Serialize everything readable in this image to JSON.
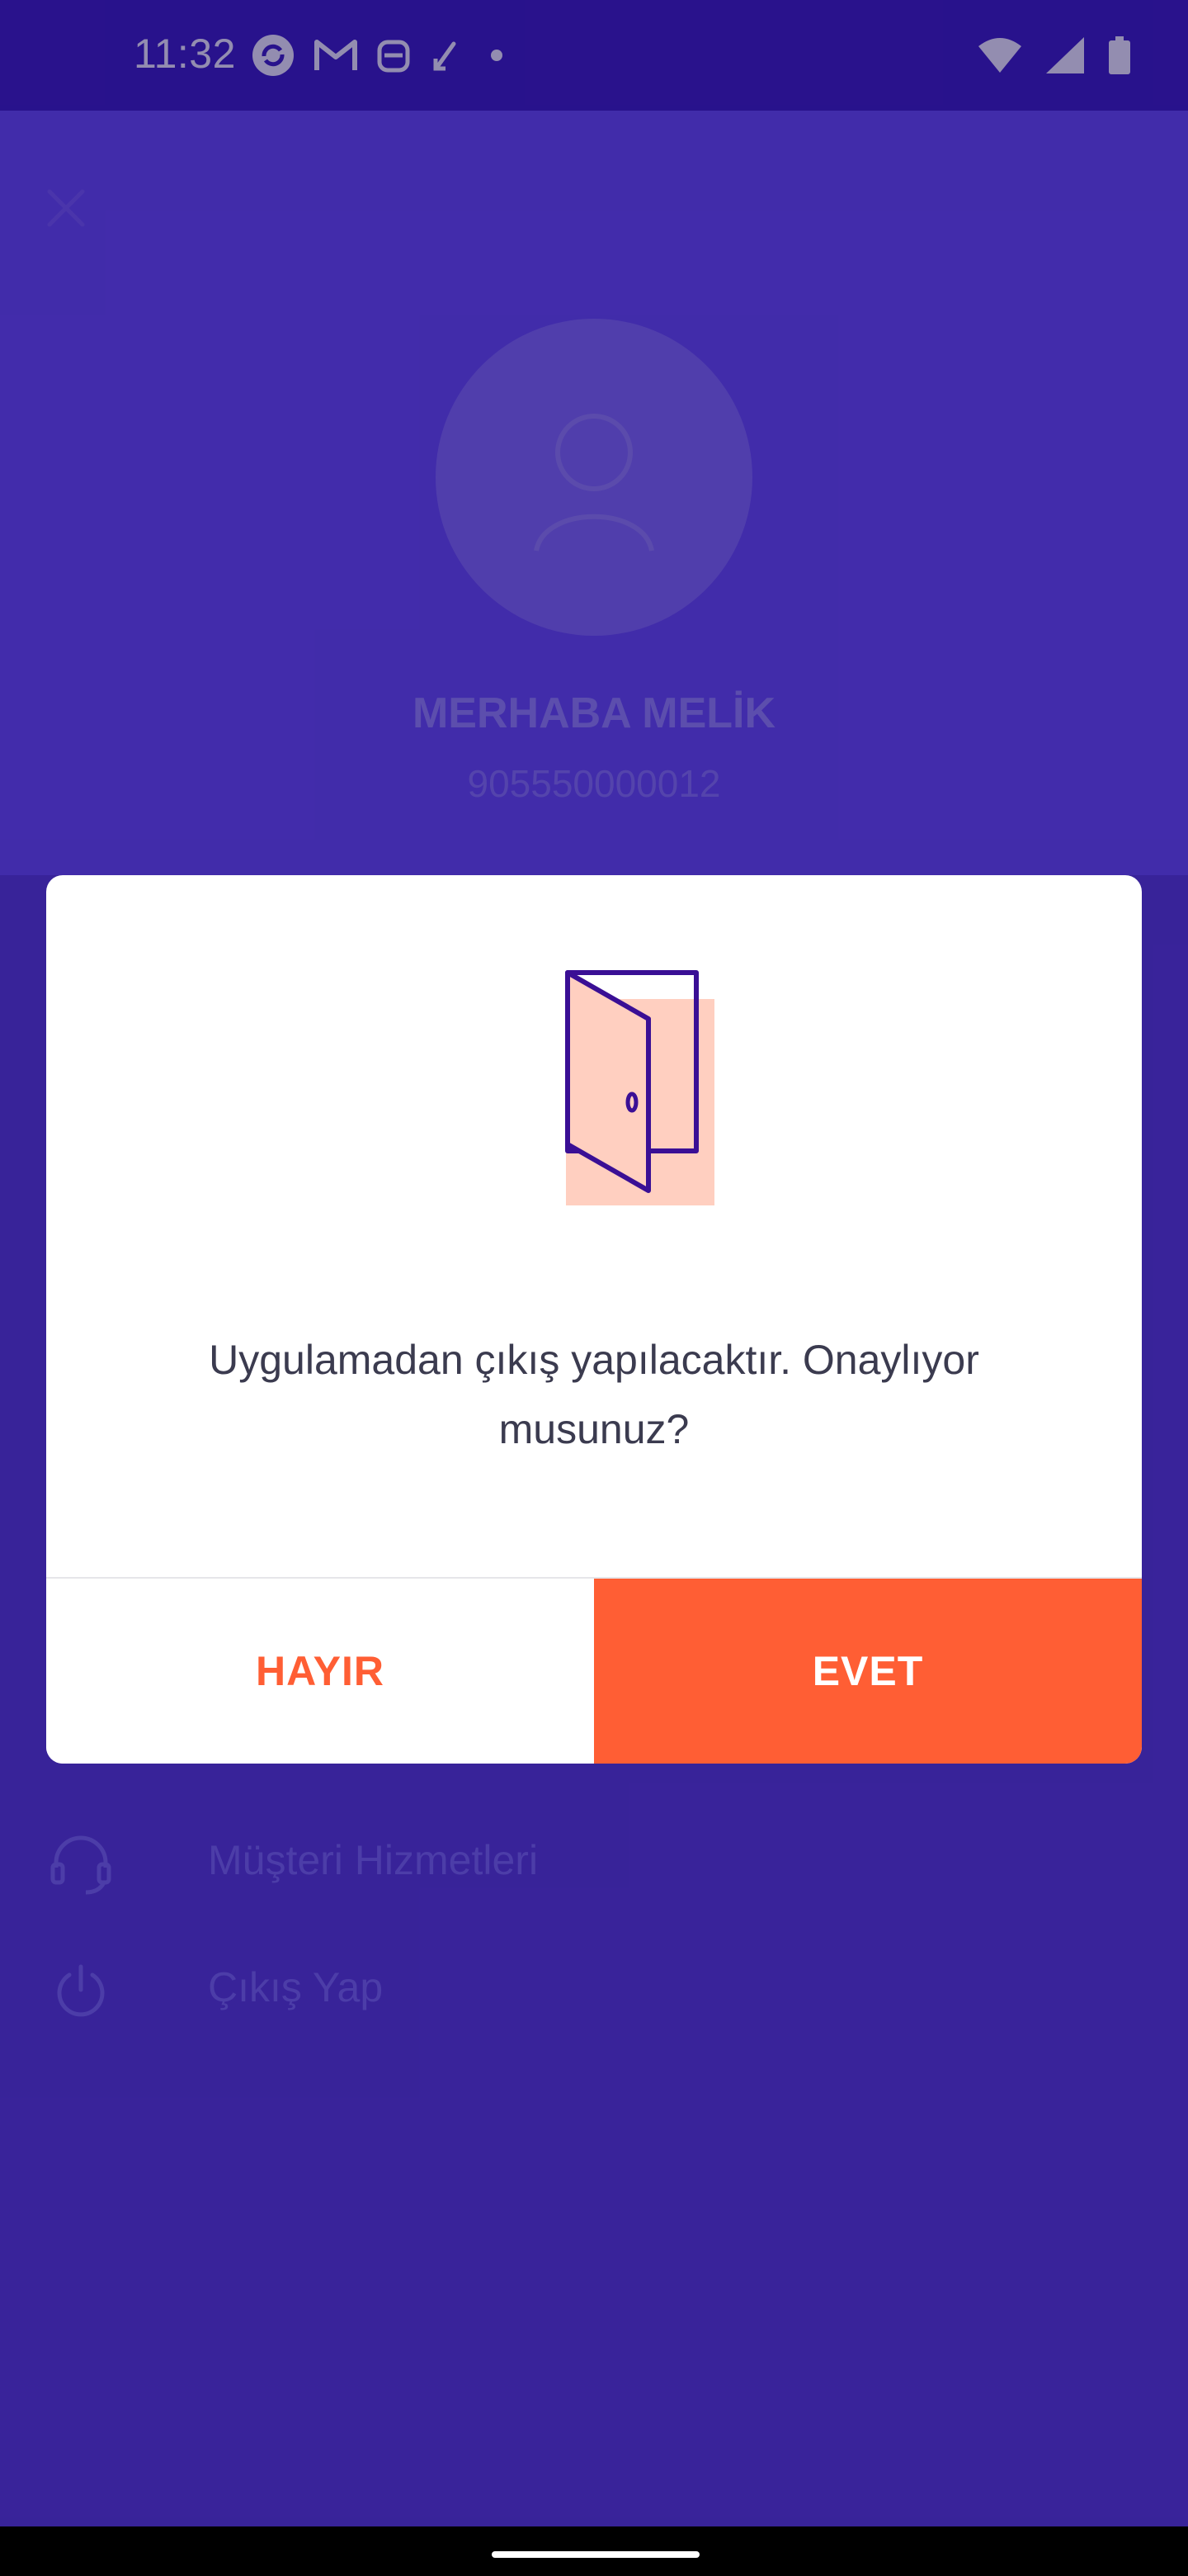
{
  "status_bar": {
    "time": "11:32",
    "left_icons": [
      "sync-icon",
      "gmail-icon",
      "bot-icon",
      "link-icon",
      "dot-icon"
    ],
    "right_icons": [
      "wifi-icon",
      "signal-icon",
      "battery-icon"
    ]
  },
  "profile": {
    "greeting": "MERHABA MELİK",
    "phone": "905550000012"
  },
  "menu": {
    "items": [
      {
        "label": "Müşteri Hizmetleri",
        "icon": "headset-icon"
      },
      {
        "label": "Çıkış Yap",
        "icon": "power-icon"
      }
    ]
  },
  "dialog": {
    "icon": "door-icon",
    "message": "Uygulamadan çıkış yapılacaktır. Onaylıyor musunuz?",
    "no_label": "HAYIR",
    "yes_label": "EVET"
  },
  "colors": {
    "status_bar": "#3d1fbd",
    "background": "#5a3ed6",
    "accent": "#ff5e34",
    "door_outline": "#3a0f95",
    "door_fill": "#ffcfc0"
  }
}
